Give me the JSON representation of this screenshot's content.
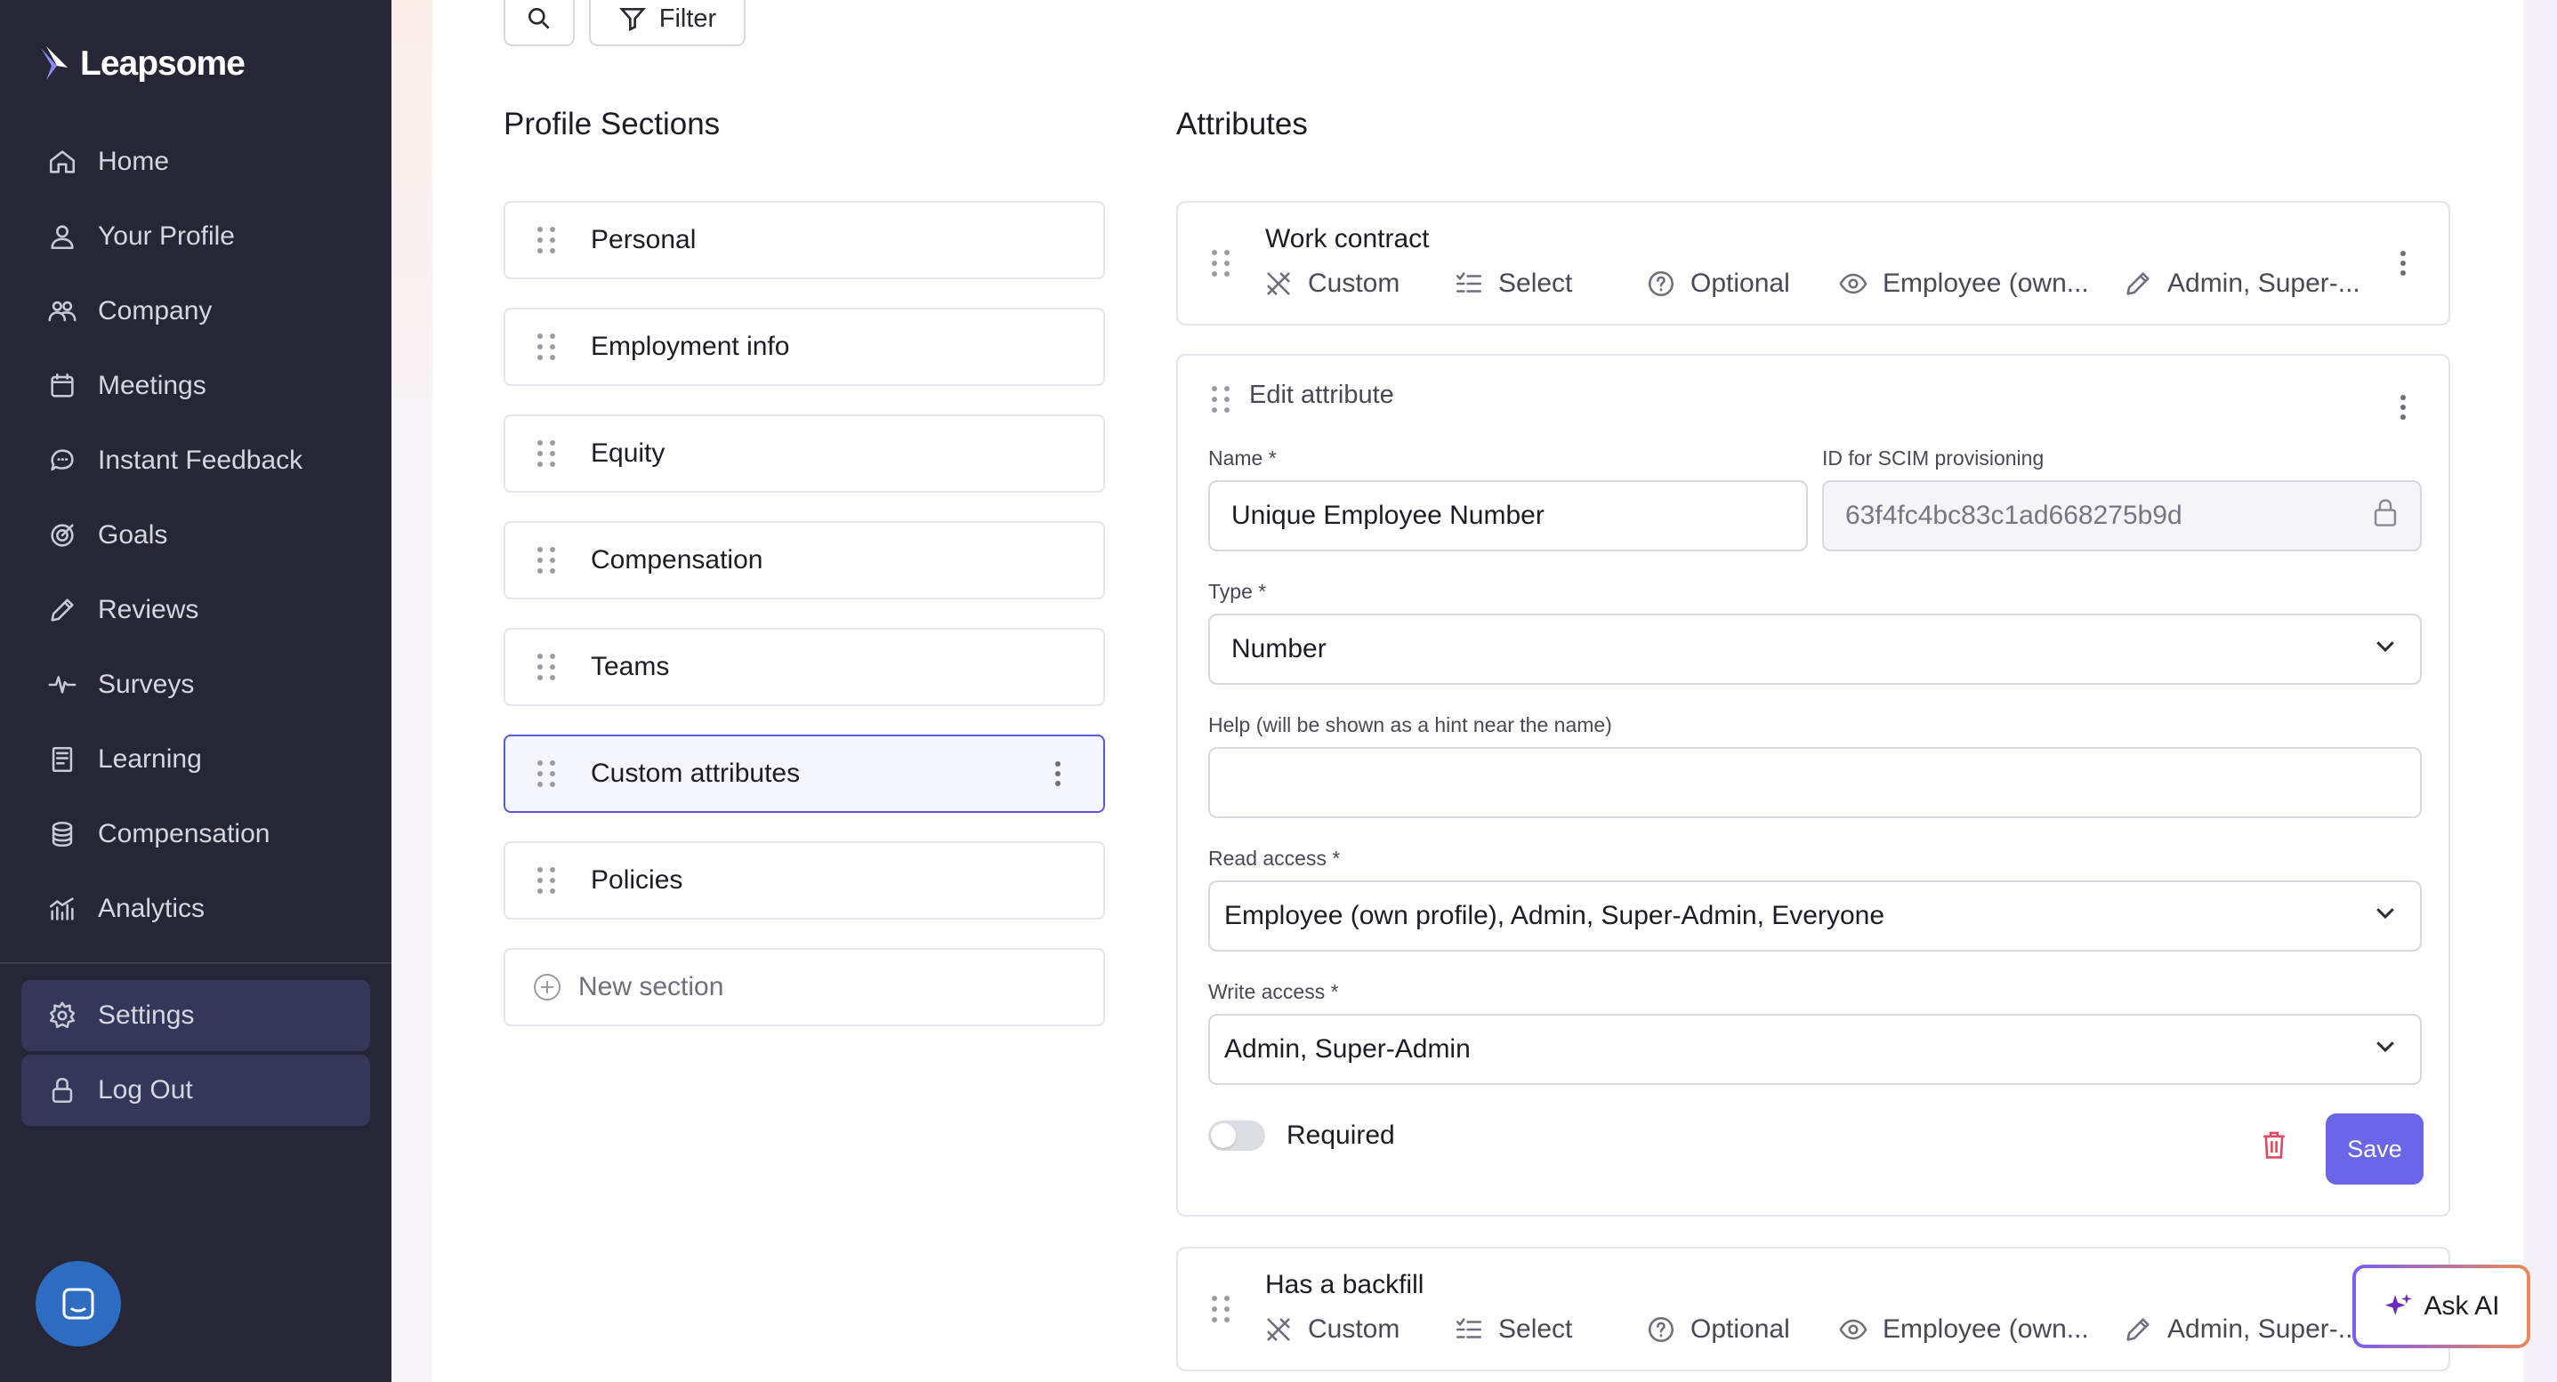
{
  "app": {
    "name": "Leapsome"
  },
  "sidebar": {
    "items": [
      {
        "label": "Home",
        "icon": "home-icon"
      },
      {
        "label": "Your Profile",
        "icon": "user-icon"
      },
      {
        "label": "Company",
        "icon": "users-icon"
      },
      {
        "label": "Meetings",
        "icon": "calendar-icon"
      },
      {
        "label": "Instant Feedback",
        "icon": "chat-icon"
      },
      {
        "label": "Goals",
        "icon": "target-icon"
      },
      {
        "label": "Reviews",
        "icon": "pencil-icon"
      },
      {
        "label": "Surveys",
        "icon": "pulse-icon"
      },
      {
        "label": "Learning",
        "icon": "book-icon"
      },
      {
        "label": "Compensation",
        "icon": "coins-icon"
      },
      {
        "label": "Analytics",
        "icon": "chart-icon"
      }
    ],
    "bottom": [
      {
        "label": "Settings",
        "icon": "gear-icon"
      },
      {
        "label": "Log Out",
        "icon": "lock-icon"
      }
    ]
  },
  "toolbar": {
    "filter_label": "Filter"
  },
  "profile_sections": {
    "title": "Profile Sections",
    "items": [
      "Personal",
      "Employment info",
      "Equity",
      "Compensation",
      "Teams",
      "Custom attributes",
      "Policies"
    ],
    "active": "Custom attributes",
    "new_label": "New section"
  },
  "attributes": {
    "title": "Attributes",
    "cards": [
      {
        "name": "Work contract",
        "source": "Custom",
        "type": "Select",
        "requirement": "Optional",
        "read": "Employee (own...",
        "write": "Admin, Super-..."
      },
      {
        "name": "Has a backfill",
        "source": "Custom",
        "type": "Select",
        "requirement": "Optional",
        "read": "Employee (own...",
        "write": "Admin, Super-..."
      }
    ]
  },
  "edit_attribute": {
    "title": "Edit attribute",
    "name_label": "Name *",
    "name_value": "Unique Employee Number",
    "scim_label": "ID for SCIM provisioning",
    "scim_value": "63f4fc4bc83c1ad668275b9d",
    "type_label": "Type *",
    "type_value": "Number",
    "help_label": "Help (will be shown as a hint near the name)",
    "help_value": "",
    "read_label": "Read access *",
    "read_value": "Employee (own profile), Admin, Super-Admin, Everyone",
    "write_label": "Write access *",
    "write_value": "Admin, Super-Admin",
    "required_label": "Required",
    "required": false,
    "save_label": "Save"
  },
  "ask_ai": {
    "label": "Ask AI"
  },
  "colors": {
    "sidebar_bg": "#262636",
    "accent": "#6b65e8",
    "danger": "#e0495f"
  }
}
